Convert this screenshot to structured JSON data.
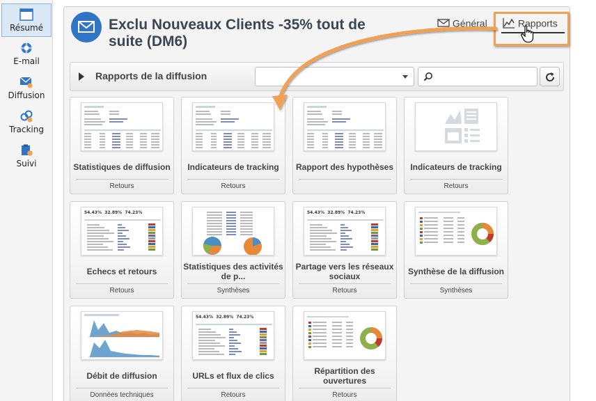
{
  "sidenav": {
    "items": [
      {
        "label": "Résumé",
        "icon": "summary-icon",
        "active": true
      },
      {
        "label": "E-mail",
        "icon": "email-lifebuoy-icon"
      },
      {
        "label": "Diffusion",
        "icon": "delivery-icon"
      },
      {
        "label": "Tracking",
        "icon": "tracking-icon"
      },
      {
        "label": "Suivi",
        "icon": "monitoring-icon"
      }
    ]
  },
  "header": {
    "title": "Exclu Nouveaux Clients -35% tout de suite (DM6)",
    "icon": "envelope-icon"
  },
  "tabs": [
    {
      "label": "Général",
      "icon": "envelope-icon"
    },
    {
      "label": "Rapports",
      "icon": "chart-line-icon",
      "active": true
    }
  ],
  "toolbar": {
    "title": "Rapports de la diffusion",
    "filter_value": "",
    "search_value": ""
  },
  "reports": [
    {
      "title": "Statistiques de diffusion",
      "category": "Retours",
      "thumb": "table"
    },
    {
      "title": "Indicateurs de tracking",
      "category": "Retours",
      "thumb": "table"
    },
    {
      "title": "Rapport des hypothèses",
      "category": "",
      "thumb": "table"
    },
    {
      "title": "Indicateurs de tracking",
      "category": "Retours",
      "thumb": "placeholder"
    },
    {
      "title": "Echecs et retours",
      "category": "Retours",
      "thumb": "kpi"
    },
    {
      "title": "Statistiques des activités de p...",
      "category": "Synthèses",
      "thumb": "pies"
    },
    {
      "title": "Partage vers les réseaux sociaux",
      "category": "Retours",
      "thumb": "kpi"
    },
    {
      "title": "Synthèse de la diffusion",
      "category": "Synthèses",
      "thumb": "donut"
    },
    {
      "title": "Débit de diffusion",
      "category": "Données techniques",
      "thumb": "area"
    },
    {
      "title": "URLs et flux de clics",
      "category": "Retours",
      "thumb": "kpi"
    },
    {
      "title": "Répartition des ouvertures",
      "category": "Retours",
      "thumb": "donut"
    }
  ],
  "kpi_values": [
    "54.43%",
    "32.89%",
    "74.23%"
  ],
  "colors": {
    "accent_blue": "#2f74c5",
    "highlight_orange": "#f0a152",
    "donut_green": "#8fb04a",
    "donut_orange": "#e8893a",
    "pie_blue": "#4a8ec4"
  }
}
